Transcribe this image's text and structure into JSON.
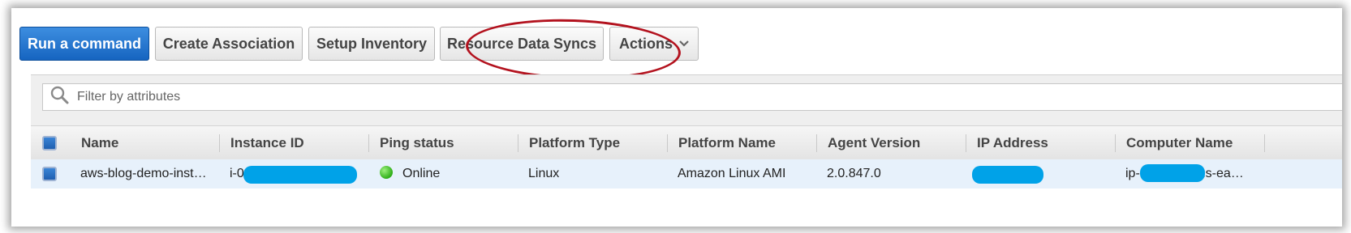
{
  "toolbar": {
    "run_command": "Run a command",
    "create_association": "Create Association",
    "setup_inventory": "Setup Inventory",
    "resource_data_syncs": "Resource Data Syncs",
    "actions": "Actions"
  },
  "filter": {
    "placeholder": "Filter by attributes"
  },
  "table": {
    "columns": [
      "Name",
      "Instance ID",
      "Ping status",
      "Platform Type",
      "Platform Name",
      "Agent Version",
      "IP Address",
      "Computer Name"
    ],
    "rows": [
      {
        "name": "aws-blog-demo-inst…",
        "instance_id": "i-0",
        "ping_status": "Online",
        "platform_type": "Linux",
        "platform_name": "Amazon Linux AMI",
        "agent_version": "2.0.847.0",
        "ip_address": "",
        "computer_name_prefix": "ip-",
        "computer_name_suffix": "us-ea…"
      }
    ]
  },
  "icons": {
    "search": "search-icon",
    "caret": "chevron-down-icon",
    "status": "status-online-icon"
  },
  "colors": {
    "primary_button": "#1664c0",
    "highlight_ellipse": "#b3121e",
    "redaction": "#00a2e8",
    "online": "#2fae18",
    "selected_row": "#e7f1fb"
  }
}
